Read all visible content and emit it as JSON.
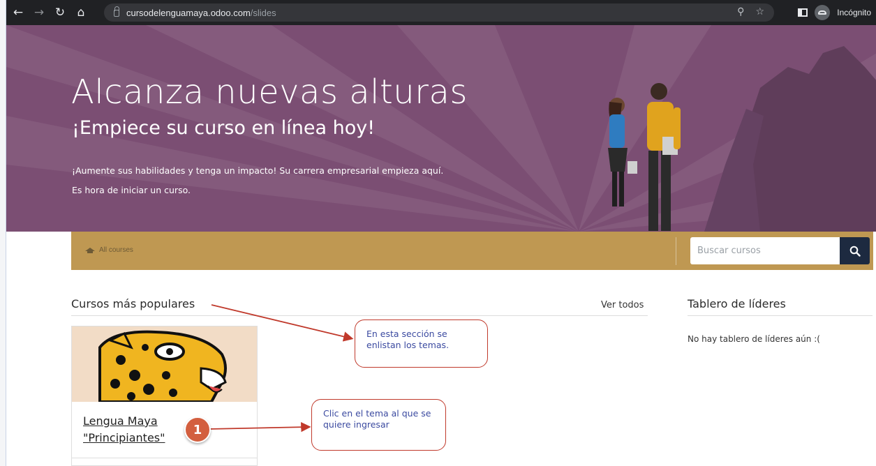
{
  "browser": {
    "url_host": "cursodelenguamaya.odoo.com",
    "url_path": "/slides",
    "profile_label": "Incógnito",
    "icons": [
      "back-icon",
      "forward-icon",
      "reload-icon",
      "home-icon",
      "lock-icon",
      "zoom-icon",
      "star-icon",
      "side-panel-icon",
      "incognito-icon"
    ]
  },
  "hero": {
    "title": "Alcanza nuevas alturas",
    "subtitle": "¡Empiece su curso en línea hoy!",
    "line1": "¡Aumente sus habilidades y tenga un impacto! Su carrera empresarial empieza aquí.",
    "line2": "Es hora de iniciar un curso.",
    "bg_color": "#7b4e73"
  },
  "searchbar": {
    "all_courses_label": "All courses",
    "search_placeholder": "Buscar cursos",
    "bar_color": "#bf9852",
    "button_color": "#1d2a40"
  },
  "main": {
    "popular_title": "Cursos más populares",
    "view_all_label": "Ver todos",
    "course": {
      "title_line1": "Lengua Maya",
      "title_line2": "\"Principiantes\""
    }
  },
  "leaderboard": {
    "title": "Tablero de líderes",
    "empty_text": "No hay tablero de líderes aún :("
  },
  "annotations": {
    "callout_section": "En esta sección se enlistan los temas.",
    "callout_click": "Clic en el tema al que se quiere ingresar",
    "badge_number": "1",
    "accent_color": "#c0392b"
  }
}
